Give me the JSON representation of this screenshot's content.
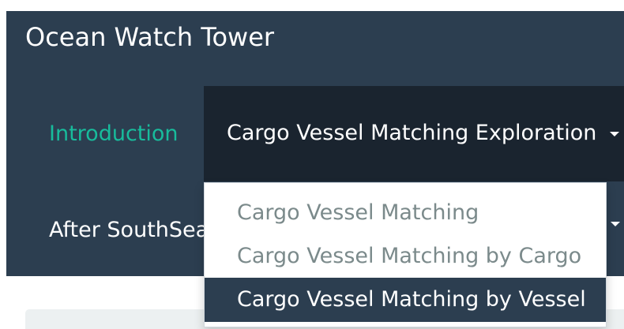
{
  "navbar": {
    "brand": "Ocean Watch Tower",
    "items": [
      {
        "label": "Introduction"
      },
      {
        "label": "Cargo Vessel Matching Exploration"
      },
      {
        "label": "After SouthSea"
      }
    ]
  },
  "dropdown": {
    "items": [
      {
        "label": "Cargo Vessel Matching"
      },
      {
        "label": "Cargo Vessel Matching by Cargo"
      },
      {
        "label": "Cargo Vessel Matching by Vessel"
      }
    ],
    "active_index": 2
  },
  "colors": {
    "navbar_bg": "#2c3e50",
    "active_tab_bg": "#1a242f",
    "accent_link": "#18bc9c",
    "menu_text": "#7b8a8b",
    "menu_active_bg": "#2c3e50",
    "panel_bg": "#ecf0f1"
  },
  "icons": {
    "dropdown_caret": "caret-down-icon"
  }
}
